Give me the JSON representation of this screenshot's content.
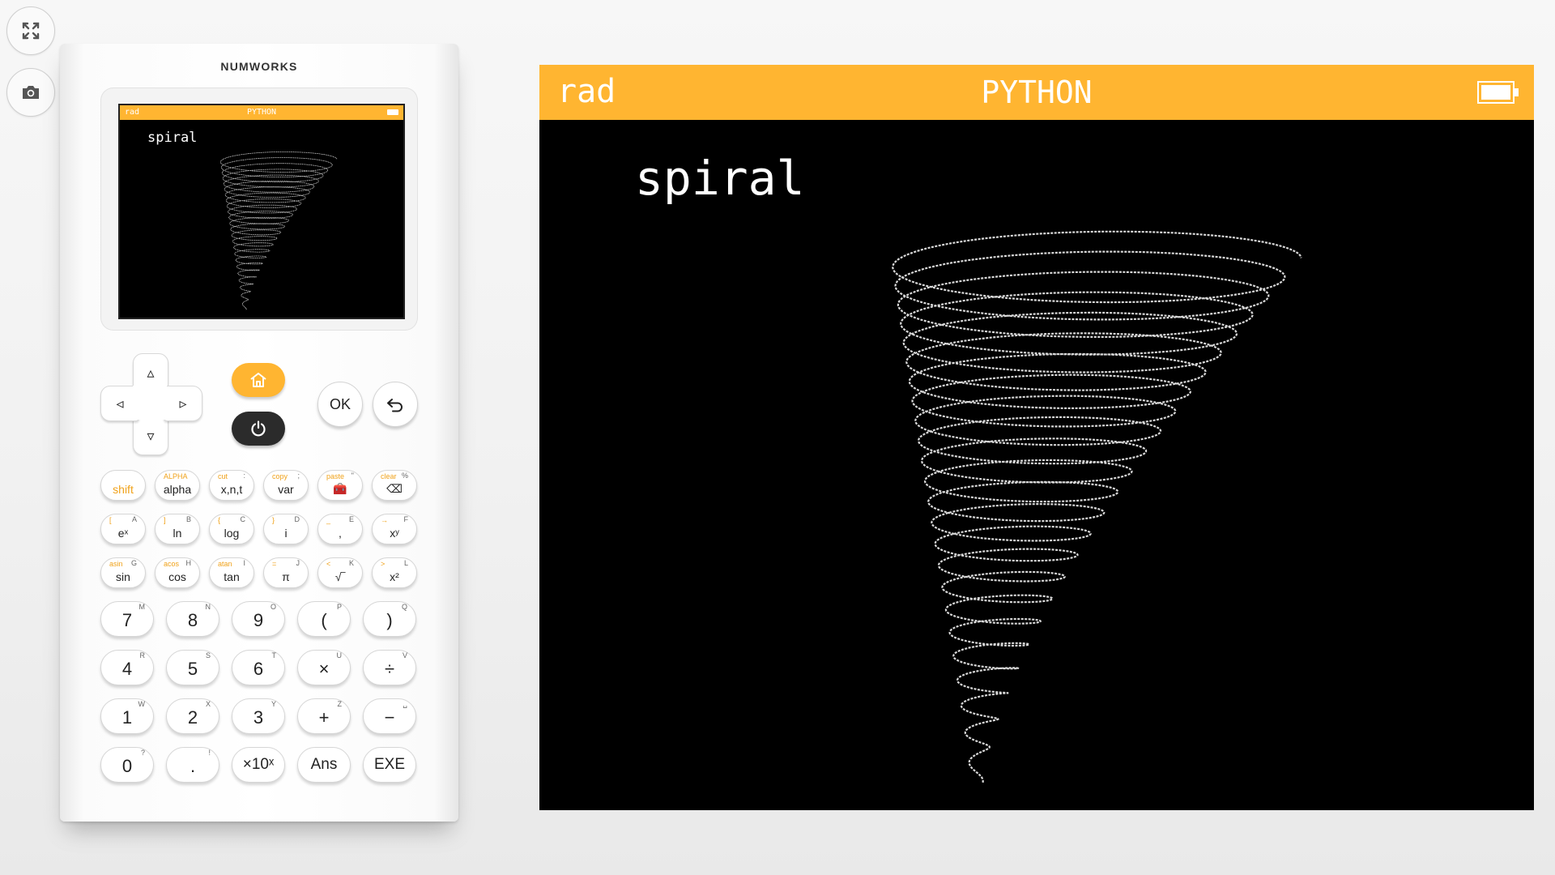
{
  "toolbar": {
    "fullscreen_icon": "fullscreen-icon",
    "screenshot_icon": "camera-icon"
  },
  "calculator": {
    "brand": "NUMWORKS",
    "status_bar": {
      "angle_mode": "rad",
      "app": "PYTHON",
      "battery_icon": "battery-icon"
    },
    "screen_label": "spiral",
    "colors": {
      "accent": "#FFB531",
      "power": "#2B2B2B",
      "screen": "#000000"
    },
    "nav": {
      "up": "▵",
      "down": "▿",
      "left": "◃",
      "right": "▹",
      "home_icon": "home-icon",
      "power_icon": "power-icon",
      "ok": "OK",
      "back_icon": "back-icon"
    },
    "function_keys": [
      [
        {
          "main": "shift",
          "sec": "",
          "alpha": ""
        },
        {
          "main": "alpha",
          "sec": "ALPHA",
          "alpha": ""
        },
        {
          "main": "x,n,t",
          "sec": "cut",
          "alpha": ":"
        },
        {
          "main": "var",
          "sec": "copy",
          "alpha": ";"
        },
        {
          "main": "🧰",
          "sec": "paste",
          "alpha": "\""
        },
        {
          "main": "⌫",
          "sec": "clear",
          "alpha": "%"
        }
      ],
      [
        {
          "main": "eˣ",
          "sec": "[",
          "alpha": "A"
        },
        {
          "main": "ln",
          "sec": "]",
          "alpha": "B"
        },
        {
          "main": "log",
          "sec": "{",
          "alpha": "C"
        },
        {
          "main": "i",
          "sec": "}",
          "alpha": "D"
        },
        {
          "main": ",",
          "sec": "_",
          "alpha": "E"
        },
        {
          "main": "xʸ",
          "sec": "→",
          "alpha": "F"
        }
      ],
      [
        {
          "main": "sin",
          "sec": "asin",
          "alpha": "G"
        },
        {
          "main": "cos",
          "sec": "acos",
          "alpha": "H"
        },
        {
          "main": "tan",
          "sec": "atan",
          "alpha": "I"
        },
        {
          "main": "π",
          "sec": "=",
          "alpha": "J"
        },
        {
          "main": "√‾",
          "sec": "<",
          "alpha": "K"
        },
        {
          "main": "x²",
          "sec": ">",
          "alpha": "L"
        }
      ]
    ],
    "number_keys": [
      [
        {
          "main": "7",
          "alpha": "M"
        },
        {
          "main": "8",
          "alpha": "N"
        },
        {
          "main": "9",
          "alpha": "O"
        },
        {
          "main": "(",
          "alpha": "P"
        },
        {
          "main": ")",
          "alpha": "Q"
        }
      ],
      [
        {
          "main": "4",
          "alpha": "R"
        },
        {
          "main": "5",
          "alpha": "S"
        },
        {
          "main": "6",
          "alpha": "T"
        },
        {
          "main": "×",
          "alpha": "U"
        },
        {
          "main": "÷",
          "alpha": "V"
        }
      ],
      [
        {
          "main": "1",
          "alpha": "W"
        },
        {
          "main": "2",
          "alpha": "X"
        },
        {
          "main": "3",
          "alpha": "Y"
        },
        {
          "main": "+",
          "alpha": "Z"
        },
        {
          "main": "−",
          "alpha": "␣"
        }
      ],
      [
        {
          "main": "0",
          "alpha": "?"
        },
        {
          "main": ".",
          "alpha": "!"
        },
        {
          "main": "×10ˣ",
          "alpha": ""
        },
        {
          "main": "Ans",
          "alpha": ""
        },
        {
          "main": "EXE",
          "alpha": ""
        }
      ]
    ]
  },
  "display": {
    "status_bar": {
      "angle_mode": "rad",
      "app": "PYTHON",
      "battery_icon": "battery-icon"
    },
    "label": "spiral"
  }
}
